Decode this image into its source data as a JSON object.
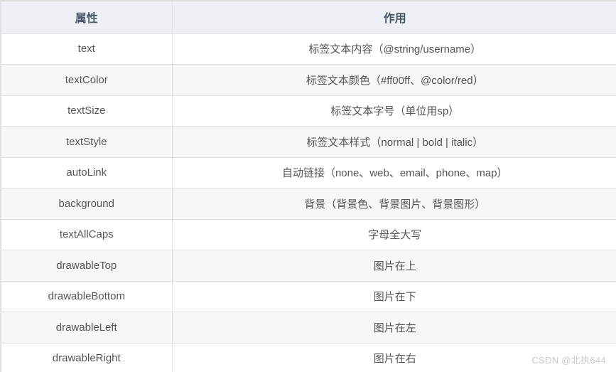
{
  "table": {
    "columns": [
      {
        "key": "attribute",
        "label": "属性"
      },
      {
        "key": "description",
        "label": "作用"
      }
    ],
    "rows": [
      {
        "attribute": "text",
        "description": "标签文本内容（@string/username）"
      },
      {
        "attribute": "textColor",
        "description": "标签文本颜色（#ff00ff、@color/red）"
      },
      {
        "attribute": "textSize",
        "description": "标签文本字号（单位用sp）"
      },
      {
        "attribute": "textStyle",
        "description": "标签文本样式（normal | bold | italic）"
      },
      {
        "attribute": "autoLink",
        "description": "自动链接（none、web、email、phone、map）"
      },
      {
        "attribute": "background",
        "description": "背景（背景色、背景图片、背景图形）"
      },
      {
        "attribute": "textAllCaps",
        "description": "字母全大写"
      },
      {
        "attribute": "drawableTop",
        "description": "图片在上"
      },
      {
        "attribute": "drawableBottom",
        "description": "图片在下"
      },
      {
        "attribute": "drawableLeft",
        "description": "图片在左"
      },
      {
        "attribute": "drawableRight",
        "description": "图片在右"
      }
    ]
  },
  "watermark": {
    "text": "CSDN @北执644"
  },
  "colors": {
    "header_background": "#edf1f5",
    "header_text": "#48576a",
    "row_background": "#ffffff",
    "row_background_alt": "#f7f7f7",
    "body_text": "#555555",
    "border": "#e2e2e2",
    "watermark_text": "#c9c9c9"
  }
}
